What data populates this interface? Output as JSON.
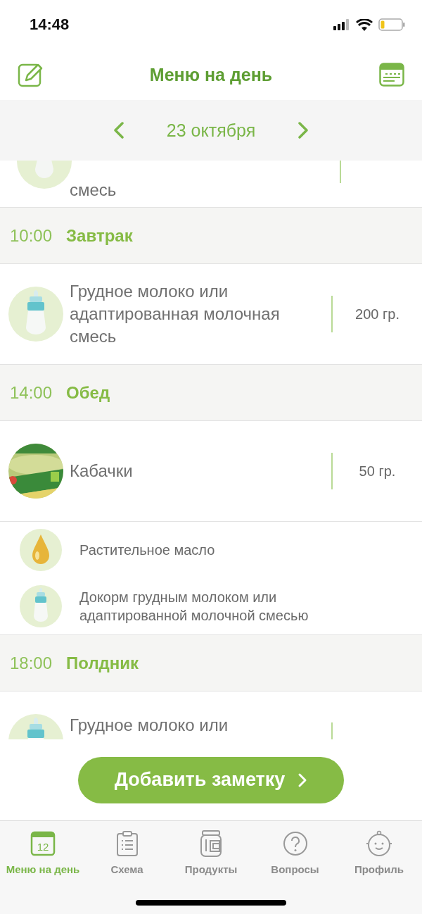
{
  "status_bar": {
    "time": "14:48"
  },
  "header": {
    "title": "Меню на день"
  },
  "date_bar": {
    "date": "23 октября"
  },
  "partial_item": {
    "kind": "milk",
    "name": "смесь"
  },
  "meals": [
    {
      "time": "10:00",
      "name": "Завтрак",
      "items": [
        {
          "kind": "milk",
          "name": "Грудное молоко или адаптированная молочная смесь",
          "amount": "200 гр."
        }
      ]
    },
    {
      "time": "14:00",
      "name": "Обед",
      "items": [
        {
          "kind": "puree",
          "name": "Кабачки",
          "amount": "50 гр.",
          "extras": [
            {
              "kind": "oil",
              "name": "Растительное масло"
            },
            {
              "kind": "milk",
              "name": "Докорм грудным молоком или адаптированной молочной смесью"
            }
          ]
        }
      ]
    },
    {
      "time": "18:00",
      "name": "Полдник",
      "items": [
        {
          "kind": "milk",
          "name": "Грудное молоко или"
        }
      ]
    }
  ],
  "add_button": {
    "label": "Добавить заметку"
  },
  "tabs": [
    {
      "kind": "calendar",
      "label": "Меню на день",
      "icon_text": "12",
      "selected": true
    },
    {
      "kind": "clipboard",
      "label": "Схема",
      "selected": false
    },
    {
      "kind": "jar",
      "label": "Продукты",
      "selected": false
    },
    {
      "kind": "question",
      "label": "Вопросы",
      "selected": false
    },
    {
      "kind": "baby",
      "label": "Профиль",
      "selected": false
    }
  ]
}
